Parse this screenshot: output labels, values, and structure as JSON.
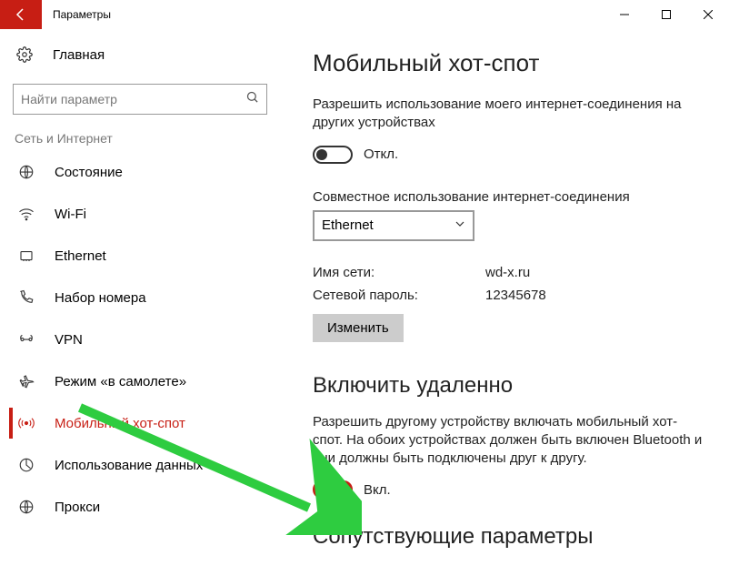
{
  "window": {
    "title": "Параметры"
  },
  "sidebar": {
    "home_label": "Главная",
    "search_placeholder": "Найти параметр",
    "category": "Сеть и Интернет",
    "items": [
      {
        "label": "Состояние"
      },
      {
        "label": "Wi-Fi"
      },
      {
        "label": "Ethernet"
      },
      {
        "label": "Набор номера"
      },
      {
        "label": "VPN"
      },
      {
        "label": "Режим «в самолете»"
      },
      {
        "label": "Мобильный хот-спот"
      },
      {
        "label": "Использование данных"
      },
      {
        "label": "Прокси"
      }
    ]
  },
  "main": {
    "heading": "Мобильный хот-спот",
    "share_desc": "Разрешить использование моего интернет-соединения на других устройствах",
    "toggle_off_label": "Откл.",
    "share_from_label": "Совместное использование интернет-соединения",
    "share_from_value": "Ethernet",
    "network_name_label": "Имя сети:",
    "network_name_value": "wd-x.ru",
    "network_pass_label": "Сетевой пароль:",
    "network_pass_value": "12345678",
    "edit_button": "Изменить",
    "remote_heading": "Включить удаленно",
    "remote_desc": "Разрешить другому устройству включать мобильный хот-спот. На обоих устройствах должен быть включен Bluetooth и они должны быть подключены друг к другу.",
    "toggle_on_label": "Вкл.",
    "related_heading": "Сопутствующие параметры"
  }
}
